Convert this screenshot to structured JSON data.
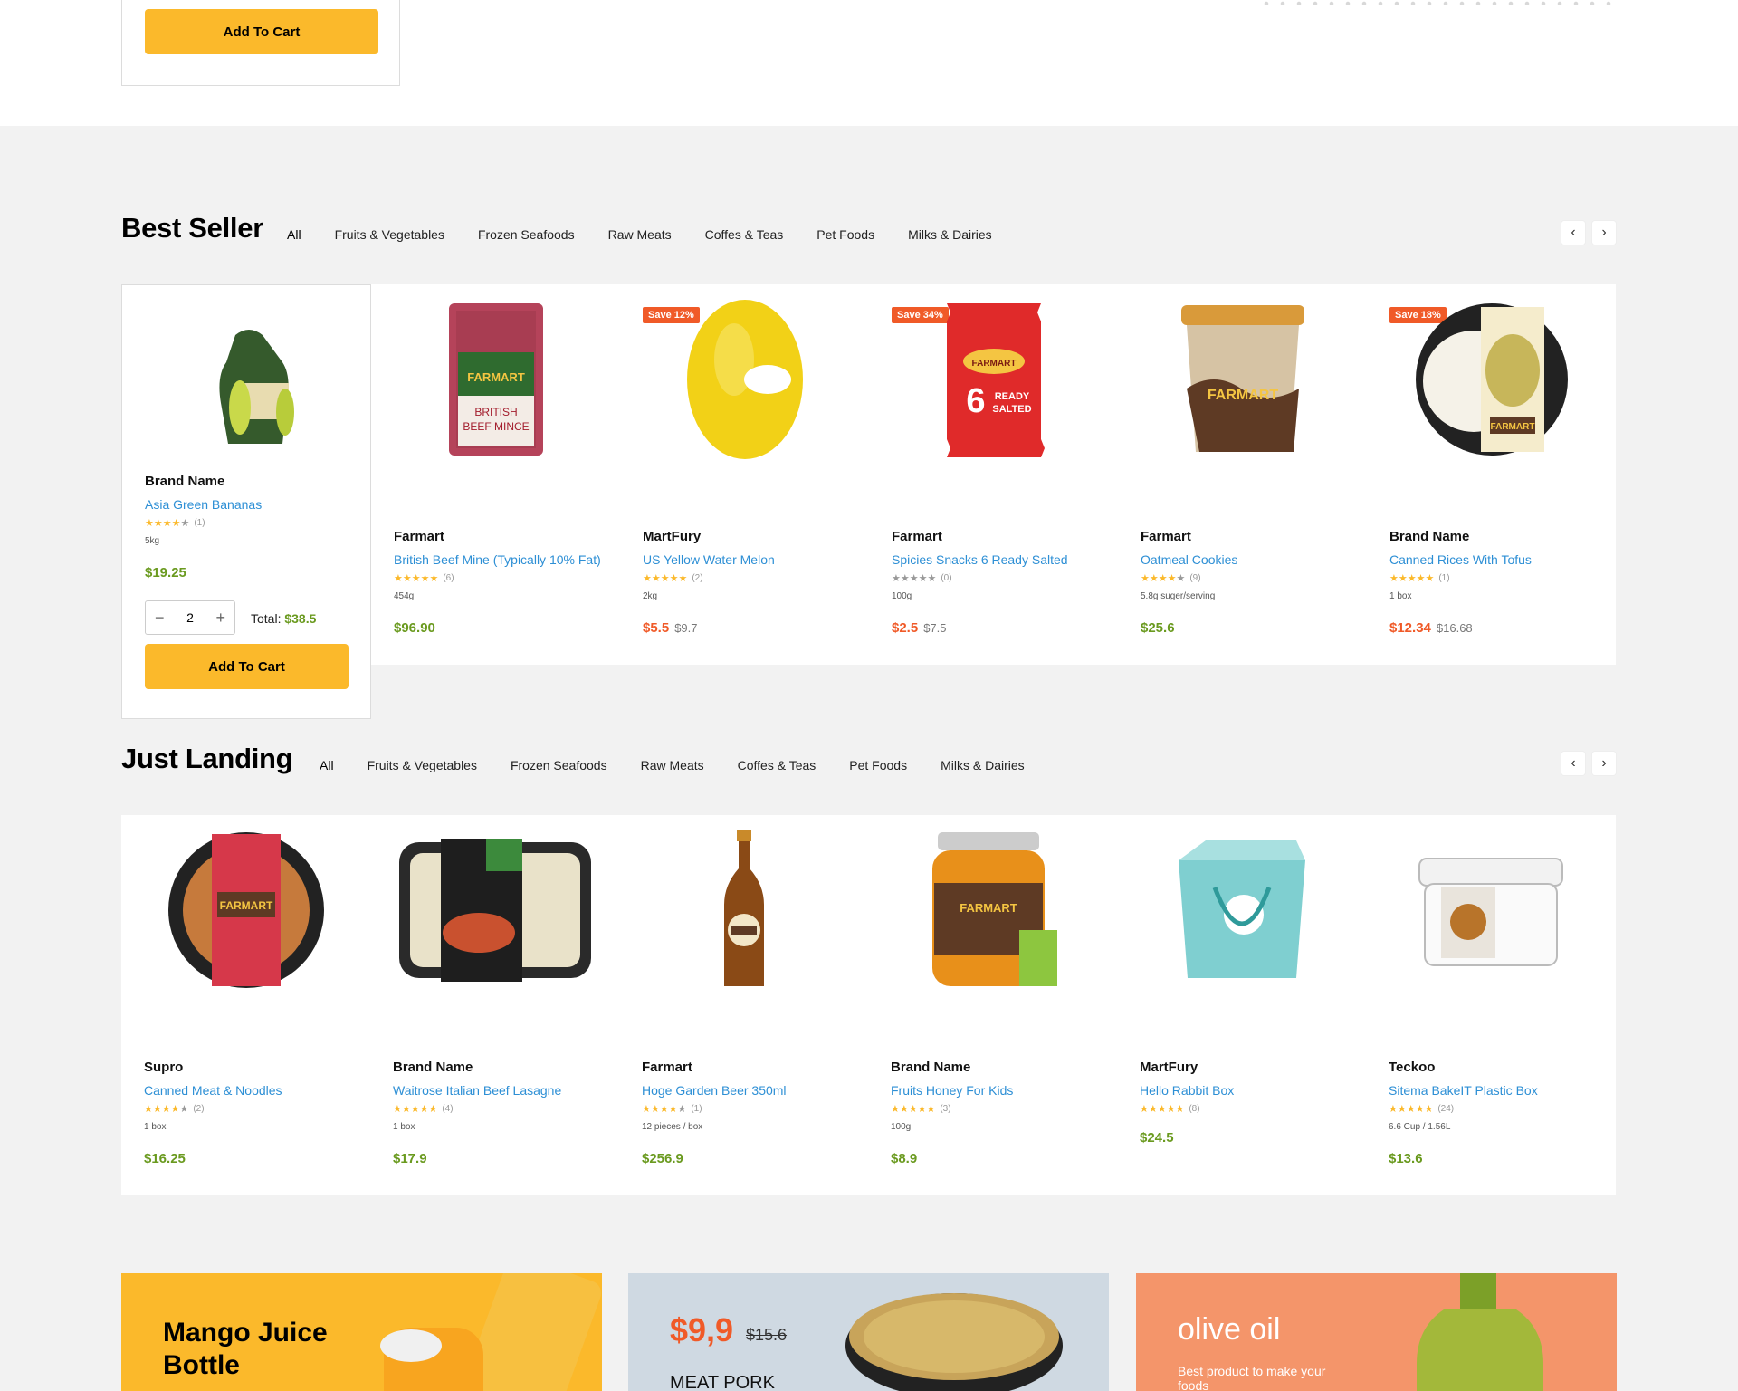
{
  "top": {
    "add_to_cart": "Add To Cart"
  },
  "tabs": [
    "All",
    "Fruits & Vegetables",
    "Frozen Seafoods",
    "Raw Meats",
    "Coffes & Teas",
    "Pet Foods",
    "Milks & Dairies"
  ],
  "best_seller": {
    "title": "Best Seller",
    "featured": {
      "brand": "Brand Name",
      "name": "Asia Green Bananas",
      "rating_count": "(1)",
      "stars": 4,
      "weight": "5kg",
      "price": "$19.25",
      "quantity": "2",
      "total_label": "Total:",
      "total_value": "$38.5",
      "add_to_cart": "Add To Cart"
    },
    "products": [
      {
        "brand": "Farmart",
        "name": "British Beef Mine (Typically 10% Fat)",
        "stars": 5,
        "rating_count": "(6)",
        "weight": "454g",
        "price": "$96.90",
        "old_price": "",
        "badge": ""
      },
      {
        "brand": "MartFury",
        "name": "US Yellow Water Melon",
        "stars": 5,
        "rating_count": "(2)",
        "weight": "2kg",
        "price": "$5.5",
        "old_price": "$9.7",
        "badge": "Save 12%"
      },
      {
        "brand": "Farmart",
        "name": "Spicies Snacks 6 Ready Salted",
        "stars": 0,
        "rating_count": "(0)",
        "weight": "100g",
        "price": "$2.5",
        "old_price": "$7.5",
        "badge": "Save 34%"
      },
      {
        "brand": "Farmart",
        "name": "Oatmeal Cookies",
        "stars": 4,
        "rating_count": "(9)",
        "weight": "5.8g suger/serving",
        "price": "$25.6",
        "old_price": "",
        "badge": ""
      },
      {
        "brand": "Brand Name",
        "name": "Canned Rices With Tofus",
        "stars": 5,
        "rating_count": "(1)",
        "weight": "1 box",
        "price": "$12.34",
        "old_price": "$16.68",
        "badge": "Save 18%"
      }
    ]
  },
  "just_landing": {
    "title": "Just Landing",
    "products": [
      {
        "brand": "Supro",
        "name": "Canned Meat & Noodles",
        "stars": 4,
        "rating_count": "(2)",
        "weight": "1 box",
        "price": "$16.25"
      },
      {
        "brand": "Brand Name",
        "name": "Waitrose Italian Beef Lasagne",
        "stars": 5,
        "rating_count": "(4)",
        "weight": "1 box",
        "price": "$17.9"
      },
      {
        "brand": "Farmart",
        "name": "Hoge Garden Beer 350ml",
        "stars": 4,
        "rating_count": "(1)",
        "weight": "12 pieces / box",
        "price": "$256.9"
      },
      {
        "brand": "Brand Name",
        "name": "Fruits Honey For Kids",
        "stars": 5,
        "rating_count": "(3)",
        "weight": "100g",
        "price": "$8.9"
      },
      {
        "brand": "MartFury",
        "name": "Hello Rabbit Box",
        "stars": 5,
        "rating_count": "(8)",
        "weight": "",
        "price": "$24.5"
      },
      {
        "brand": "Teckoo",
        "name": "Sitema BakeIT Plastic Box",
        "stars": 5,
        "rating_count": "(24)",
        "weight": "6.6 Cup / 1.56L",
        "price": "$13.6"
      }
    ]
  },
  "promos": {
    "p1": {
      "title": "Mango Juice Bottle"
    },
    "p2": {
      "price": "$9,9",
      "old_price": "$15.6",
      "label": "MEAT PORK"
    },
    "p3": {
      "title": "olive oil",
      "subtitle": "Best product to make your foods"
    }
  },
  "colors": {
    "accent": "#fbb92b",
    "link": "#2d8fd5",
    "price": "#6a9a1f",
    "sale": "#f05a28"
  },
  "icons": {
    "prev": "chevron-left-icon",
    "next": "chevron-right-icon",
    "minus": "minus-icon",
    "plus": "plus-icon"
  }
}
